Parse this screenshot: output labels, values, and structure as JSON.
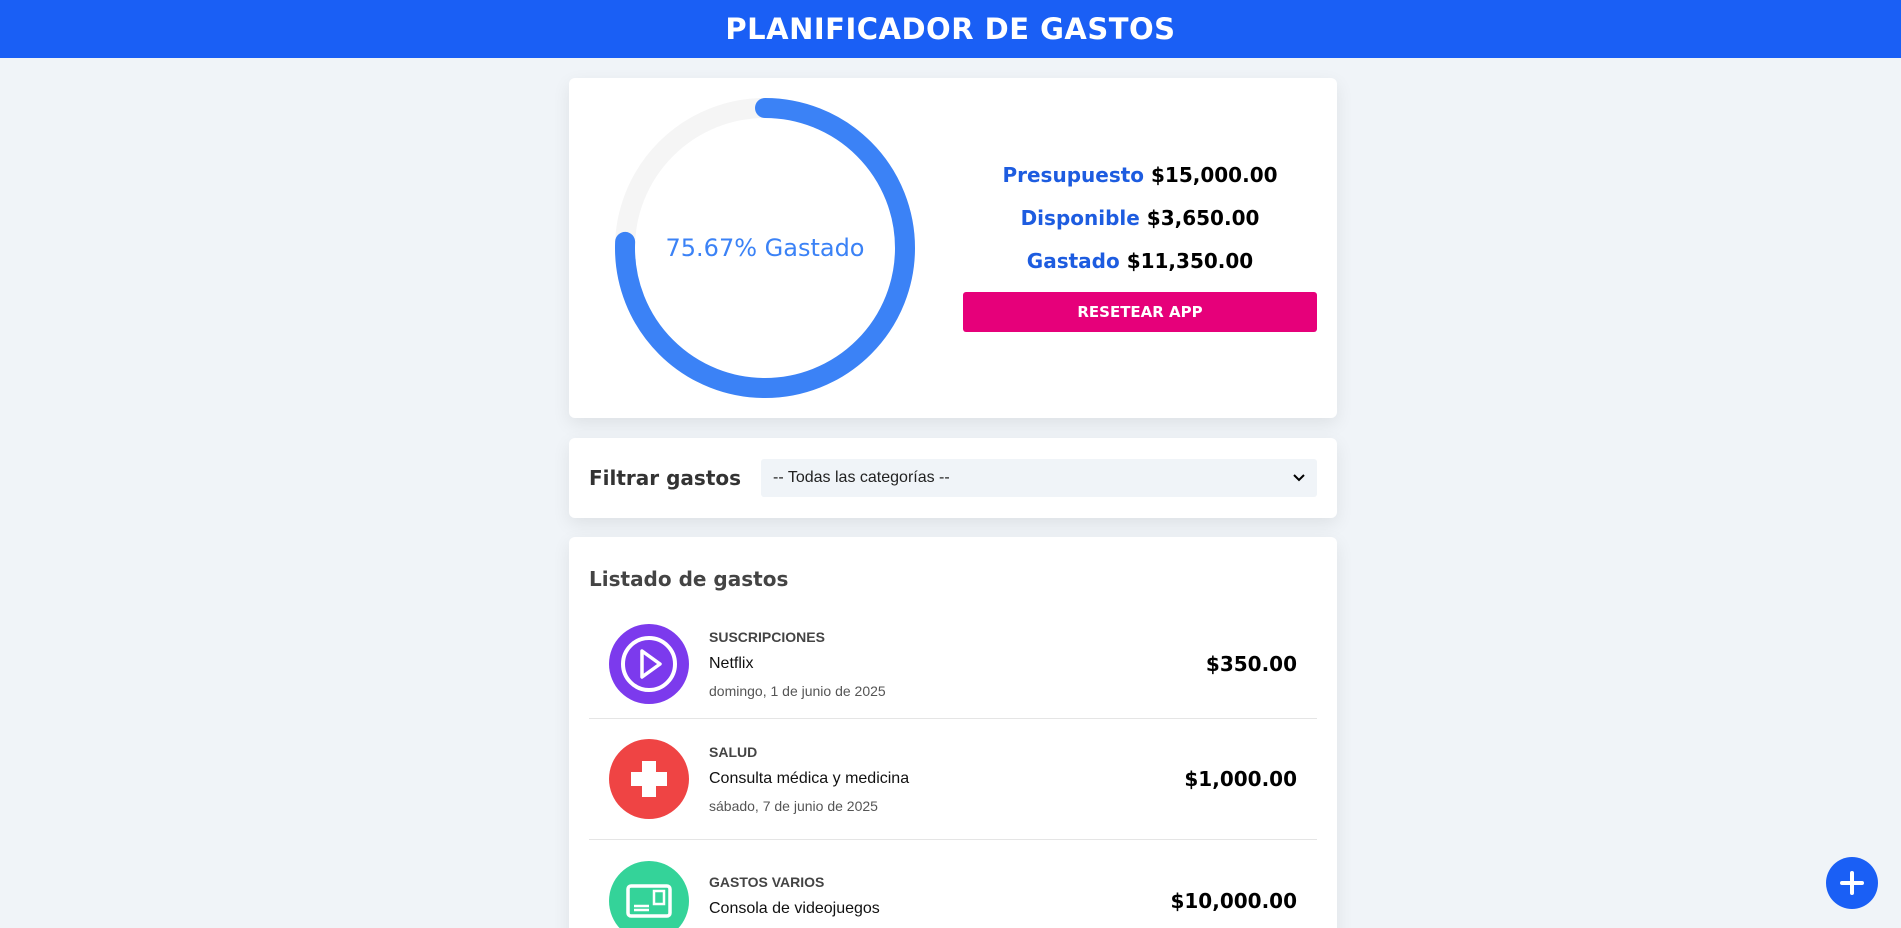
{
  "app": {
    "title": "PLANIFICADOR DE GASTOS"
  },
  "budget": {
    "percent_spent": 75.67,
    "progress_text": "75.67% Gastado",
    "budget_label": "Presupuesto",
    "budget_value": "$15,000.00",
    "available_label": "Disponible",
    "available_value": "$3,650.00",
    "spent_label": "Gastado",
    "spent_value": "$11,350.00",
    "reset_label": "RESETEAR APP",
    "colors": {
      "progress": "#3b82f6",
      "track": "#f5f5f5",
      "reset": "#e6007a",
      "label": "#1d5ce0"
    }
  },
  "filter": {
    "label": "Filtrar gastos",
    "selected": "-- Todas las categorías --"
  },
  "list": {
    "title": "Listado de gastos",
    "items": [
      {
        "category": "SUSCRIPCIONES",
        "name": "Netflix",
        "date": "domingo, 1 de junio de 2025",
        "amount": "$350.00",
        "icon": "play-icon",
        "color": "#7c3aed"
      },
      {
        "category": "SALUD",
        "name": "Consulta médica y medicina",
        "date": "sábado, 7 de junio de 2025",
        "amount": "$1,000.00",
        "icon": "health-cross-icon",
        "color": "#ef4444"
      },
      {
        "category": "GASTOS VARIOS",
        "name": "Consola de videojuegos",
        "date": "",
        "amount": "$10,000.00",
        "icon": "card-icon",
        "color": "#34d399"
      }
    ]
  },
  "fab": {
    "icon": "plus-icon"
  }
}
